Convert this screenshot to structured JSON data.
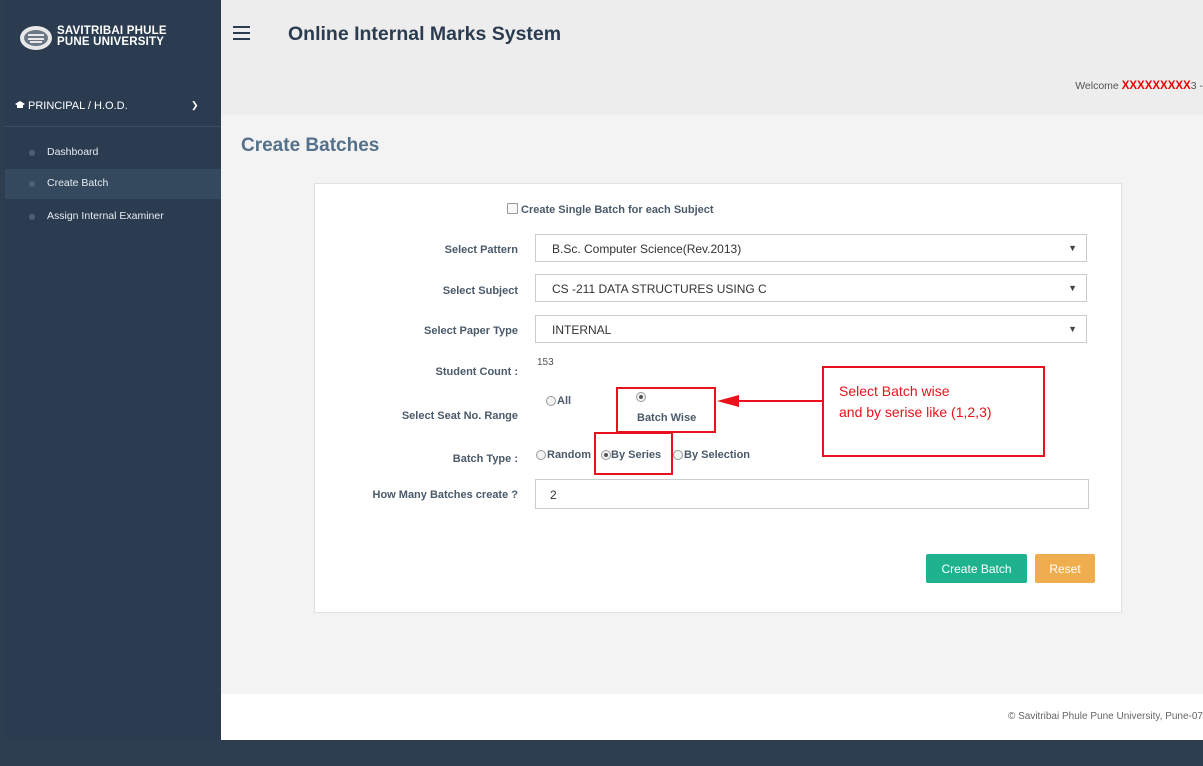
{
  "brand": {
    "line1": "SAVITRIBAI PHULE",
    "line2": "PUNE UNIVERSITY"
  },
  "header": {
    "title": "Online Internal Marks System",
    "welcome_prefix": "Welcome ",
    "welcome_name": "XXXXXXXXX",
    "welcome_suffix": "3 -"
  },
  "sidebar": {
    "role": "PRINCIPAL / H.O.D.",
    "items": [
      {
        "label": "Dashboard"
      },
      {
        "label": "Create Batch"
      },
      {
        "label": "Assign Internal Examiner"
      }
    ]
  },
  "page": {
    "title": "Create Batches"
  },
  "form": {
    "single_batch_label": "Create Single Batch for each Subject",
    "pattern_label": "Select Pattern",
    "pattern_value": "B.Sc. Computer Science(Rev.2013)",
    "subject_label": "Select Subject",
    "subject_value": "CS -211 DATA STRUCTURES USING C",
    "paper_type_label": "Select Paper Type",
    "paper_type_value": "INTERNAL",
    "student_count_label": "Student Count :",
    "student_count_value": "153",
    "seat_range_label": "Select Seat No. Range",
    "seat_all": "All",
    "seat_batch_wise": "Batch Wise",
    "batch_type_label": "Batch Type :",
    "batch_random": "Random",
    "batch_series": "By Series",
    "batch_selection": "By Selection",
    "how_many_label": "How Many Batches create ?",
    "how_many_value": "2",
    "create_button": "Create Batch",
    "reset_button": "Reset"
  },
  "annotation": {
    "line1": "Select Batch wise",
    "line2": "and by serise like (1,2,3)"
  },
  "footer": {
    "text": "© Savitribai Phule Pune University, Pune-07"
  },
  "colors": {
    "sidebar": "#2b3c50",
    "accent": "#1abc9c",
    "create": "#1fb28f",
    "reset": "#f0ad4e",
    "annotation": "#e8121c"
  }
}
